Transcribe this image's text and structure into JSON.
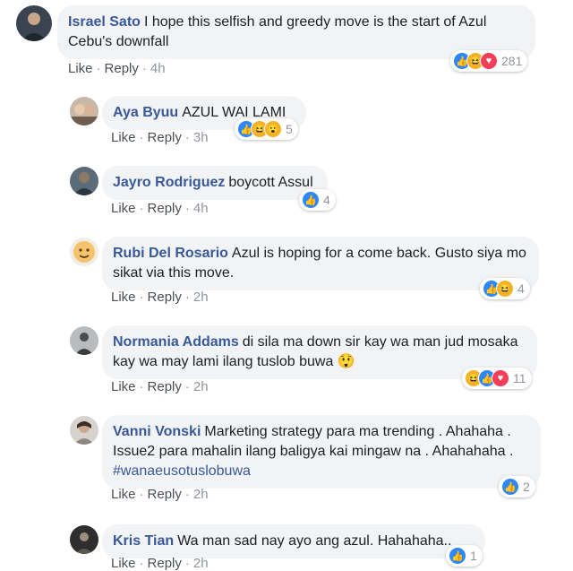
{
  "comments": [
    {
      "name": "Israel Sato",
      "text": "I hope this selfish and greedy move is the start of Azul Cebu's downfall",
      "like": "Like",
      "reply": "Reply",
      "time": "4h",
      "reaction_icons": [
        "like-icon",
        "haha-icon",
        "love-icon"
      ],
      "reaction_count": "281"
    },
    {
      "name": "Aya Byuu",
      "text": "AZUL WAI LAMI",
      "like": "Like",
      "reply": "Reply",
      "time": "3h",
      "reaction_icons": [
        "like-icon",
        "haha-icon",
        "wow-icon"
      ],
      "reaction_count": "5"
    },
    {
      "name": "Jayro Rodriguez",
      "text": "boycott Assul",
      "like": "Like",
      "reply": "Reply",
      "time": "4h",
      "reaction_icons": [
        "like-icon"
      ],
      "reaction_count": "4"
    },
    {
      "name": "Rubi Del Rosario",
      "text": "Azul is hoping for a come back. Gusto siya mo sikat via this move.",
      "like": "Like",
      "reply": "Reply",
      "time": "2h",
      "reaction_icons": [
        "like-icon",
        "haha-icon"
      ],
      "reaction_count": "4"
    },
    {
      "name": "Normania Addams",
      "text": "di sila ma down sir kay wa man jud mosaka kay wa may lami ilang tuslob buwa 😲",
      "like": "Like",
      "reply": "Reply",
      "time": "2h",
      "reaction_icons": [
        "haha-icon",
        "like-icon",
        "love-icon"
      ],
      "reaction_count": "11"
    },
    {
      "name": "Vanni Vonski",
      "text": "Marketing strategy para ma trending . Ahahaha . Issue2 para mahalin ilang baligya kai mingaw na . Ahahahaha . ",
      "hashtag": "#wanaeusotuslobuwa",
      "like": "Like",
      "reply": "Reply",
      "time": "2h",
      "reaction_icons": [
        "like-icon"
      ],
      "reaction_count": "2"
    },
    {
      "name": "Kris Tian",
      "text": "Wa man sad nay ayo ang azul. Hahahaha..",
      "like": "Like",
      "reply": "Reply",
      "time": "2h",
      "reaction_icons": [
        "like-icon"
      ],
      "reaction_count": "1"
    }
  ],
  "colors": {
    "name": "#385898",
    "bubble": "#f2f3f5",
    "like": "#2d88ff",
    "love": "#f33e58",
    "haha": "#f7b125"
  }
}
